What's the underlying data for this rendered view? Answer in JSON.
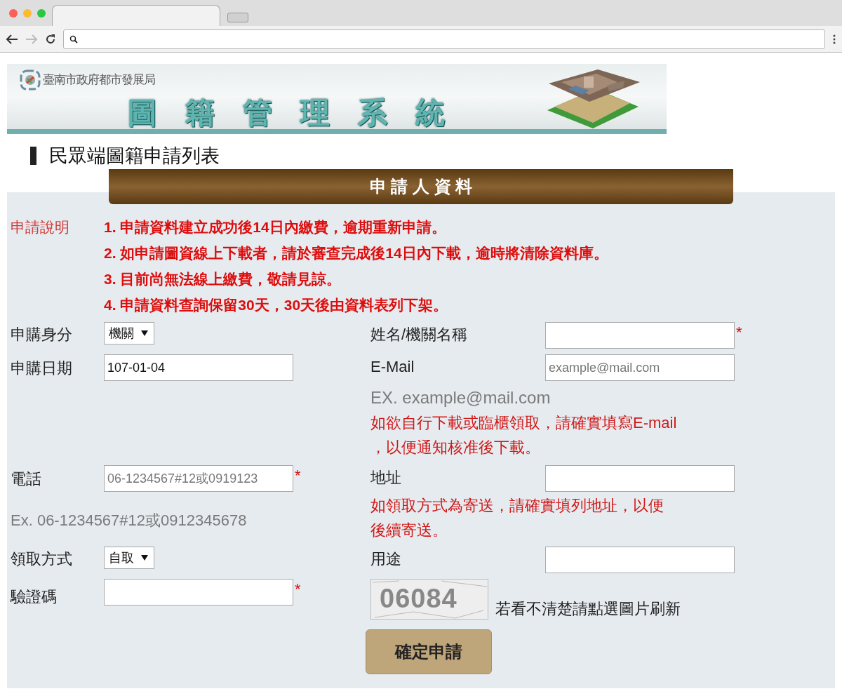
{
  "browser": {
    "tabs": [
      {
        "selected": true
      },
      {
        "selected": false
      }
    ]
  },
  "banner": {
    "agency": "臺南市政府都市發展局",
    "system": "圖籍管理系統"
  },
  "page_title": "民眾端圖籍申請列表",
  "section_title": "申 請 人 資 料",
  "notes": {
    "label": "申請說明",
    "items": [
      "1. 申請資料建立成功後14日內繳費，逾期重新申請。",
      "2. 如申請圖資線上下載者，請於審查完成後14日內下載，逾時將清除資料庫。",
      "3. 目前尚無法線上繳費，敬請見諒。",
      "4. 申請資料查詢保留30天，30天後由資料表列下架。"
    ]
  },
  "rows": [
    {
      "left": {
        "label": "申購身分",
        "kind": "select",
        "value": "機關"
      },
      "right": {
        "label": "姓名/機關名稱",
        "kind": "text",
        "required_mark": "*"
      }
    },
    {
      "left": {
        "label": "申購日期",
        "kind": "text",
        "value": "107-01-04"
      },
      "right": {
        "label": "E-Mail",
        "kind": "text",
        "placeholder": "example@mail.com",
        "hint": "EX. example@mail.com",
        "note": [
          "如欲自行下載或臨櫃領取，請確實填寫E-mail",
          "，以便通知核准後下載。"
        ]
      }
    },
    {
      "left": {
        "label": "電話",
        "kind": "text",
        "placeholder": "06-1234567#12或0919123",
        "required_mark": "*",
        "hint": "Ex. 06-1234567#12或0912345678"
      },
      "right": {
        "label": "地址",
        "kind": "text",
        "note": [
          "如領取方式為寄送，請確實填列地址，以便",
          "後續寄送。"
        ]
      }
    },
    {
      "left": {
        "label": "領取方式",
        "kind": "select",
        "value": "自取"
      },
      "right": {
        "label": "用途",
        "kind": "text"
      }
    },
    {
      "left": {
        "label": "驗證碼",
        "kind": "text",
        "required_mark": "*"
      },
      "right": {
        "kind": "captcha",
        "code": "06084",
        "hint": "若看不清楚請點選圖片刷新"
      }
    }
  ],
  "submit_button": "確定申請"
}
